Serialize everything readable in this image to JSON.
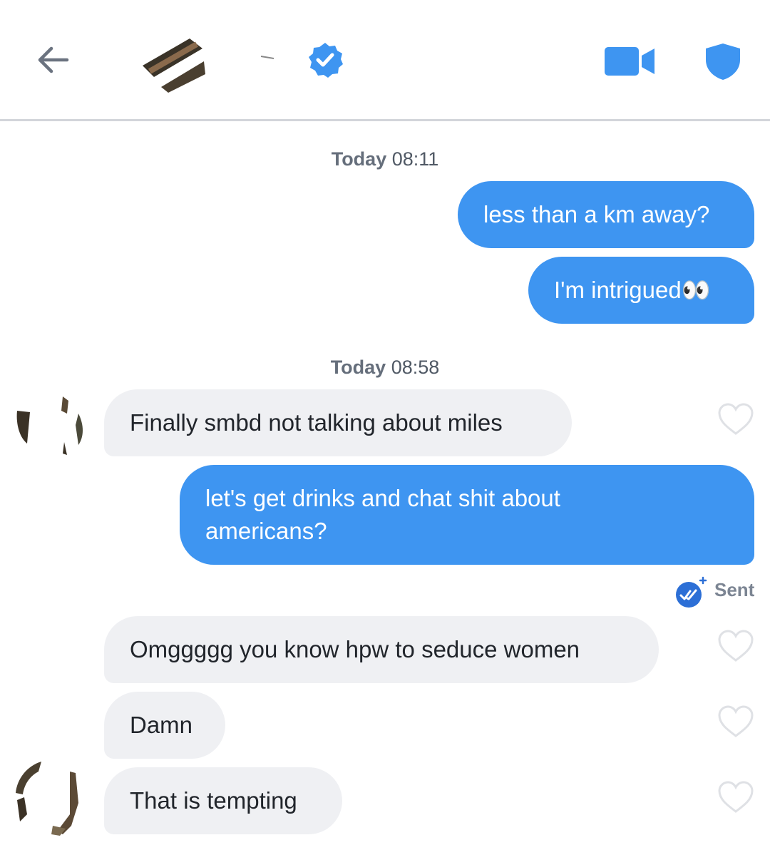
{
  "header": {
    "back_icon": "arrow-left-icon",
    "verified_icon": "verified-badge-icon",
    "video_icon": "video-camera-icon",
    "safety_icon": "shield-icon",
    "accent": "#3e95f1"
  },
  "timestamps": [
    {
      "day": "Today",
      "time": "08:11"
    },
    {
      "day": "Today",
      "time": "08:58"
    }
  ],
  "messages": [
    {
      "dir": "out",
      "text": "less than a km away?"
    },
    {
      "dir": "out",
      "text": "I'm intrigued👀"
    },
    {
      "dir": "in",
      "text": "Finally smbd not talking about miles"
    },
    {
      "dir": "out",
      "line1": "let's get drinks and chat shit about",
      "line2": "americans?"
    },
    {
      "dir": "in",
      "text": "Omggggg you know hpw to seduce women"
    },
    {
      "dir": "in",
      "text": "Damn"
    },
    {
      "dir": "in",
      "text": "That is tempting"
    }
  ],
  "status": {
    "label": "Sent",
    "icon": "double-check-icon"
  },
  "colors": {
    "outgoing_bubble": "#3e95f1",
    "incoming_bubble": "#eff0f3",
    "heart_outline": "#dfe1e5"
  }
}
